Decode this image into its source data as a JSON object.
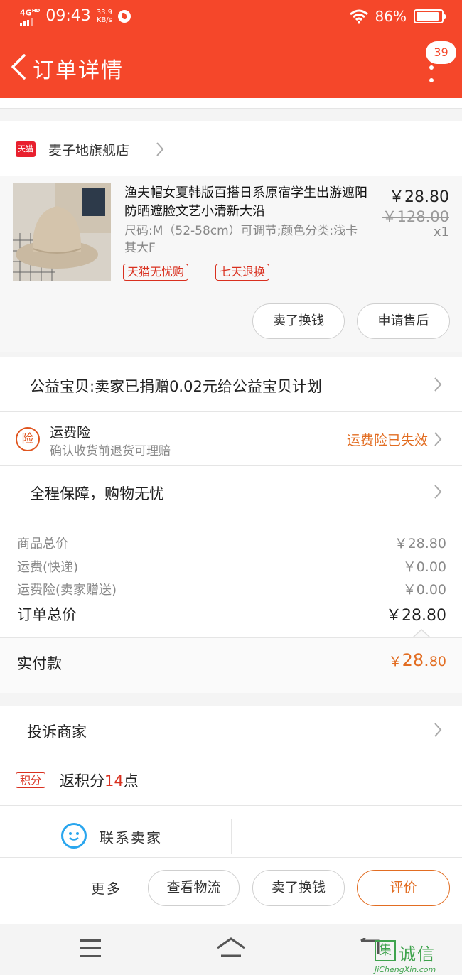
{
  "status_bar": {
    "network": "4G",
    "network_sup": "HD",
    "time": "09:43",
    "speed_value": "33.9",
    "speed_unit": "KB/s",
    "battery": "86%",
    "battery_level": 0.86
  },
  "nav": {
    "title": "订单详情",
    "badge": "39"
  },
  "shop": {
    "logo_text": "天猫",
    "name": "麦子地旗舰店"
  },
  "product": {
    "title": "渔夫帽女夏韩版百搭日系原宿学生出游遮阳防晒遮脸文艺小清新大沿",
    "sku": "尺码:M（52-58cm）可调节;颜色分类:浅卡其大F",
    "price": "￥28.80",
    "original_price": "￥128.00",
    "quantity": "x1",
    "tags": [
      "天猫无忧购",
      "七天退换"
    ],
    "actions": [
      "卖了换钱",
      "申请售后"
    ]
  },
  "charity": {
    "text": "公益宝贝:卖家已捐赠0.02元给公益宝贝计划"
  },
  "insurance": {
    "icon_text": "险",
    "title": "运费险",
    "subtitle": "确认收货前退货可理赔",
    "status": "运费险已失效"
  },
  "guarantee": {
    "text": "全程保障，购物无忧"
  },
  "summary": {
    "rows": [
      {
        "label": "商品总价",
        "value": "￥28.80"
      },
      {
        "label": "运费(快递)",
        "value": "￥0.00"
      },
      {
        "label": "运费险(卖家赠送)",
        "value": "￥0.00"
      }
    ],
    "total_label": "订单总价",
    "total_value": "￥28.80",
    "paid_label": "实付款",
    "paid_symbol": "￥",
    "paid_int": "28.",
    "paid_dec": "80"
  },
  "complaint": {
    "text": "投诉商家"
  },
  "points": {
    "icon_text": "积分",
    "prefix": "返积分",
    "count": "14",
    "suffix": "点"
  },
  "contact": {
    "label": "联系卖家"
  },
  "bottom": {
    "more": "更多",
    "logistics": "查看物流",
    "resell": "卖了换钱",
    "evaluate": "评价"
  },
  "watermark": {
    "logo_char": "集",
    "cn": "诚信",
    "en": "JiChengXin.com"
  },
  "colors": {
    "brand": "#f5472a",
    "accent_orange": "#e26d22",
    "tag_red": "#d9301f",
    "contact_blue": "#2aa6ee"
  }
}
